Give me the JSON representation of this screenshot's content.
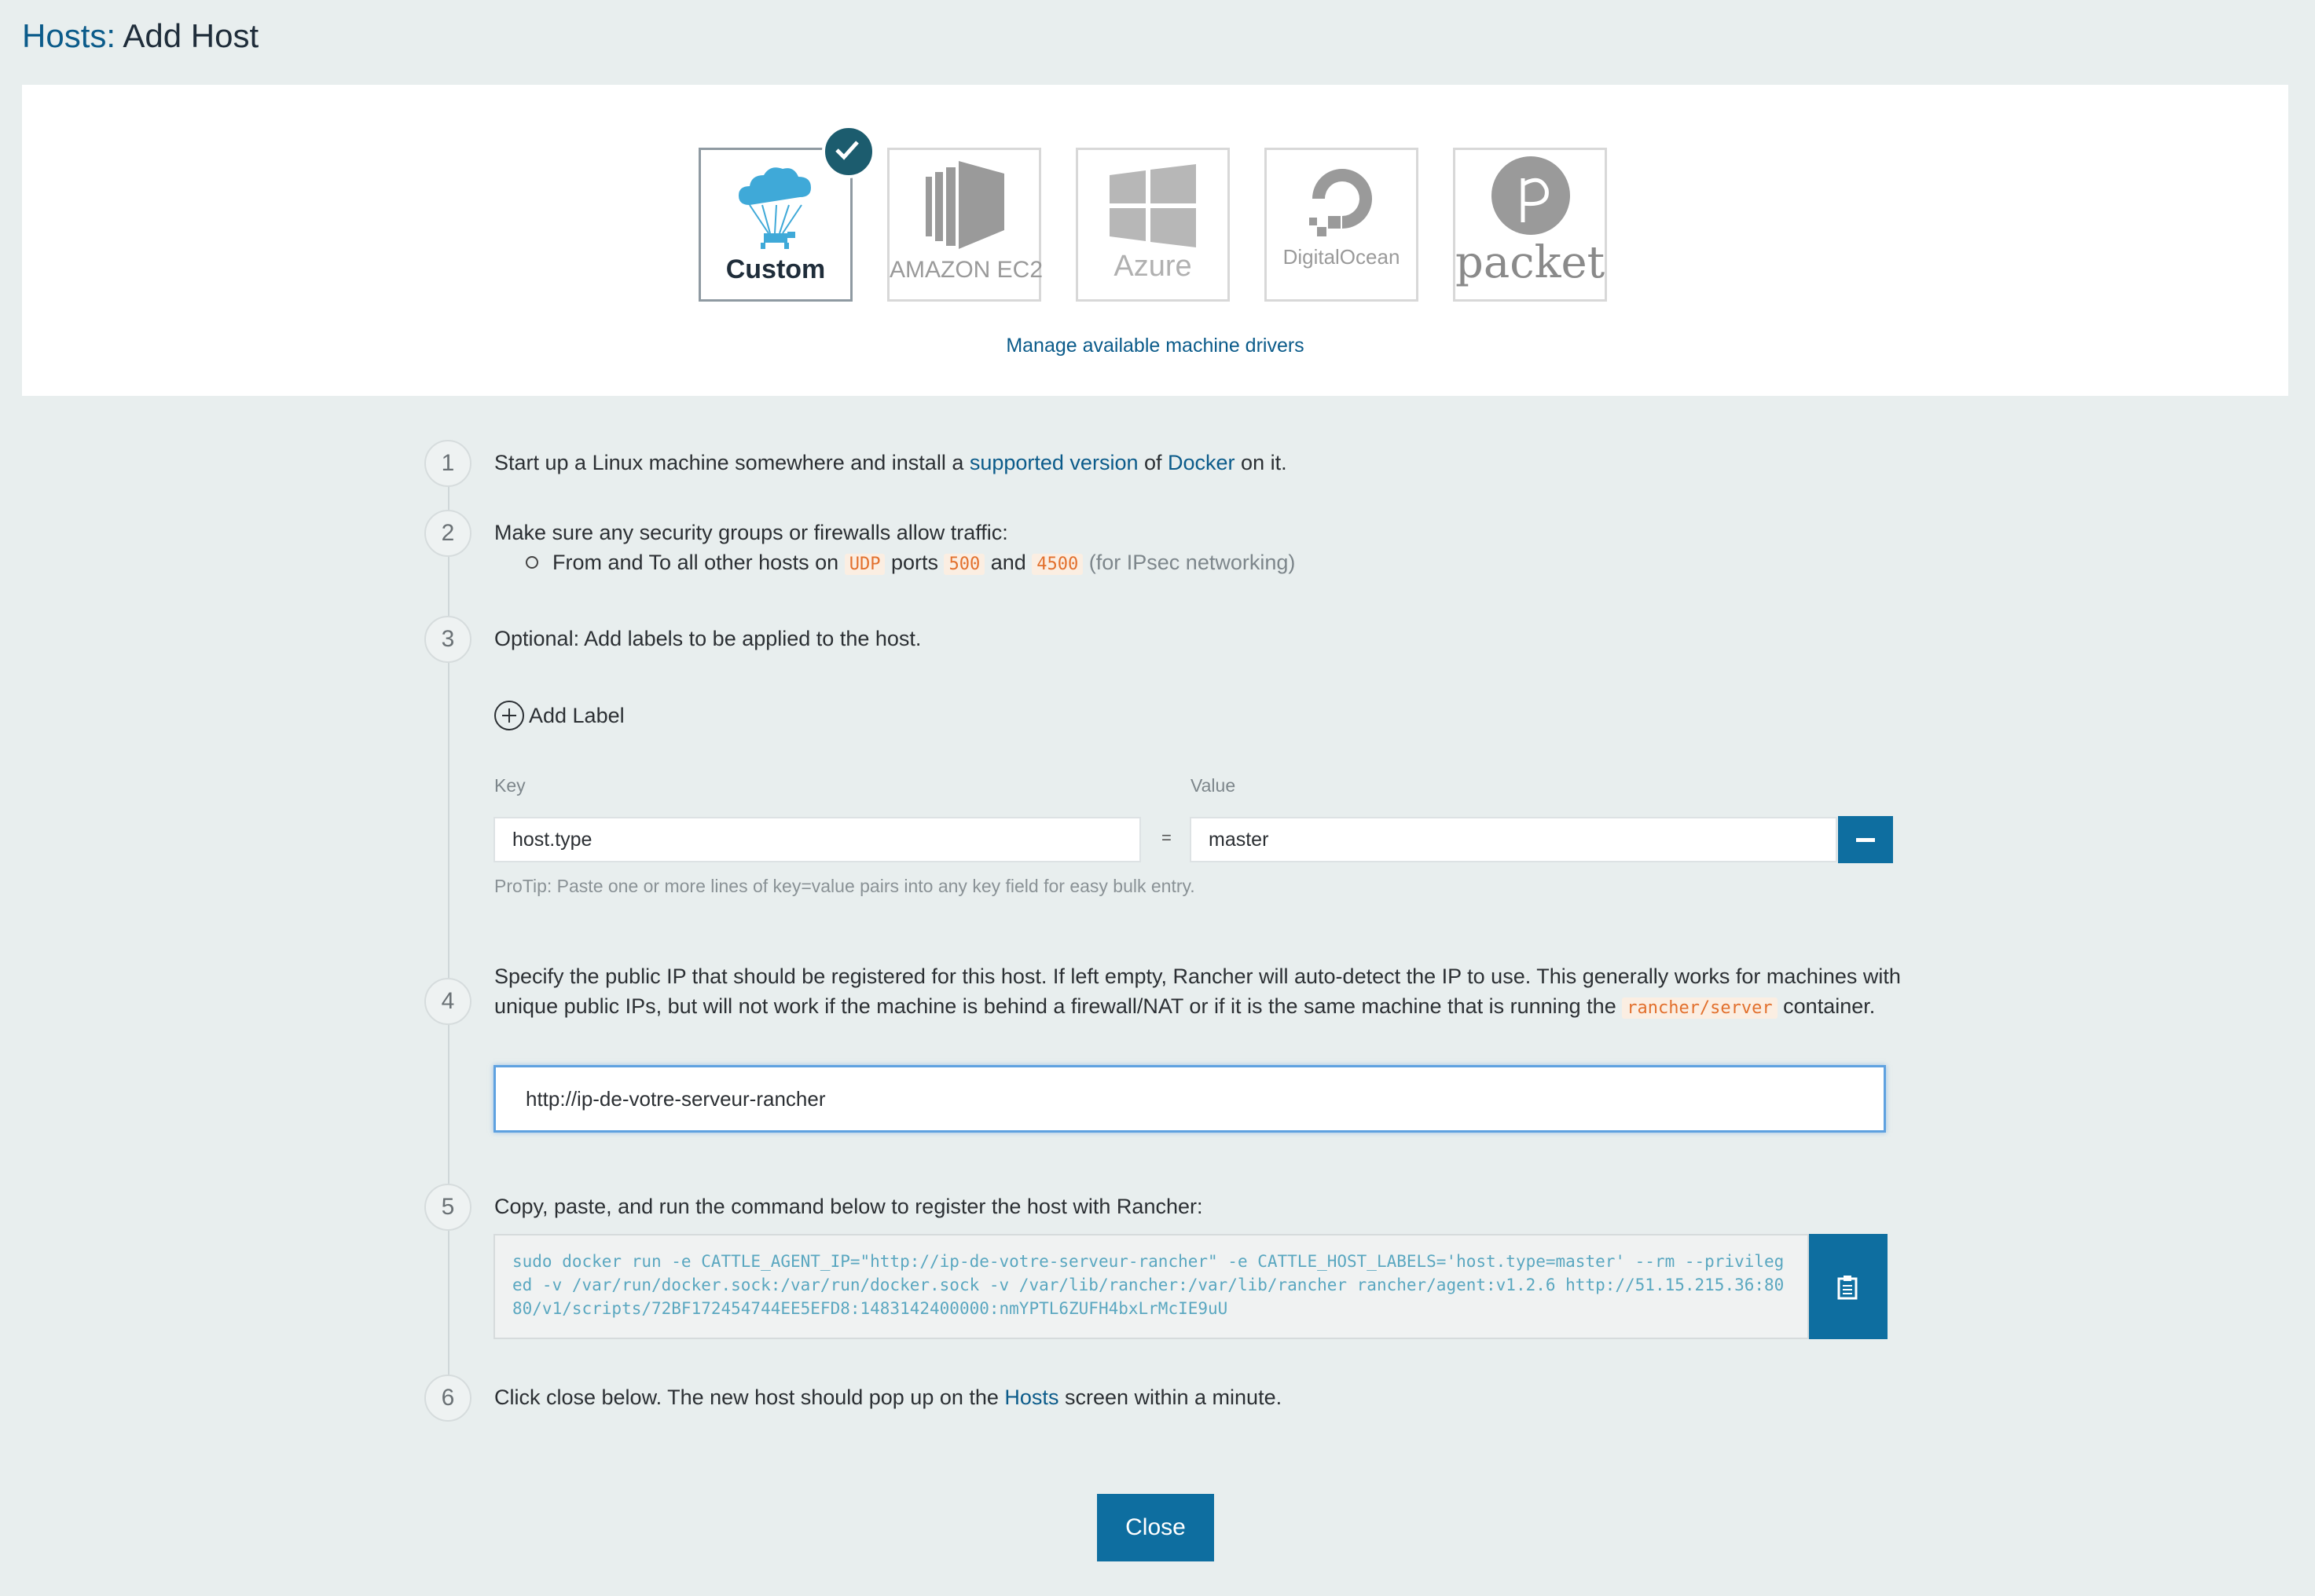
{
  "header": {
    "crumb": "Hosts:",
    "title": "Add Host"
  },
  "drivers": {
    "items": [
      {
        "label": "Custom",
        "selected": true,
        "icon": "rancher-cloud-icon"
      },
      {
        "label": "AMAZON EC2",
        "selected": false,
        "icon": "amazon-ec2-icon"
      },
      {
        "label": "Azure",
        "selected": false,
        "icon": "azure-windows-icon"
      },
      {
        "label": "DigitalOcean",
        "selected": false,
        "icon": "digitalocean-icon"
      },
      {
        "label": "packet",
        "selected": false,
        "icon": "packet-icon"
      }
    ],
    "manage_link": "Manage available machine drivers"
  },
  "steps": {
    "s1": {
      "num": "1",
      "text_a": "Start up a Linux machine somewhere and install a ",
      "link_a": "supported version",
      "text_b": " of ",
      "link_b": "Docker",
      "text_c": " on it."
    },
    "s2": {
      "num": "2",
      "text": "Make sure any security groups or firewalls allow traffic:",
      "bullet_a": "From and To all other hosts on ",
      "proto": "UDP",
      "bullet_b": " ports ",
      "port1": "500",
      "bullet_c": " and ",
      "port2": "4500",
      "note": " (for IPsec networking)"
    },
    "s3": {
      "num": "3",
      "text": "Optional: Add labels to be applied to the host.",
      "add_label": "Add Label",
      "key_label": "Key",
      "value_label": "Value",
      "key": "host.type",
      "equals": "=",
      "value": "master",
      "protip": "ProTip: Paste one or more lines of key=value pairs into any key field for easy bulk entry."
    },
    "s4": {
      "num": "4",
      "text_a": "Specify the public IP that should be registered for this host. If left empty, Rancher will auto-detect the IP to use. This generally works for machines with unique public IPs, but will not work if the machine is behind a firewall/NAT or if it is the same machine that is running the ",
      "code": "rancher/server",
      "text_b": " container.",
      "ip_value": "http://ip-de-votre-serveur-rancher"
    },
    "s5": {
      "num": "5",
      "text": "Copy, paste, and run the command below to register the host with Rancher:",
      "command": "sudo docker run -e CATTLE_AGENT_IP=\"http://ip-de-votre-serveur-rancher\"  -e CATTLE_HOST_LABELS='host.type=master'  --rm --privileged -v /var/run/docker.sock:/var/run/docker.sock -v /var/lib/rancher:/var/lib/rancher rancher/agent:v1.2.6 http://51.15.215.36:8080/v1/scripts/72BF172454744EE5EFD8:1483142400000:nmYPTL6ZUFH4bxLrMcIE9uU"
    },
    "s6": {
      "num": "6",
      "text_a": "Click close below. The new host should pop up on the ",
      "link": "Hosts",
      "text_b": " screen within a minute."
    }
  },
  "footer": {
    "close_label": "Close"
  },
  "colors": {
    "accent": "#0e6ea0",
    "link": "#0b5b8a",
    "check": "#1c5c6e",
    "code": "#e2702d",
    "command": "#5aa7c0"
  }
}
